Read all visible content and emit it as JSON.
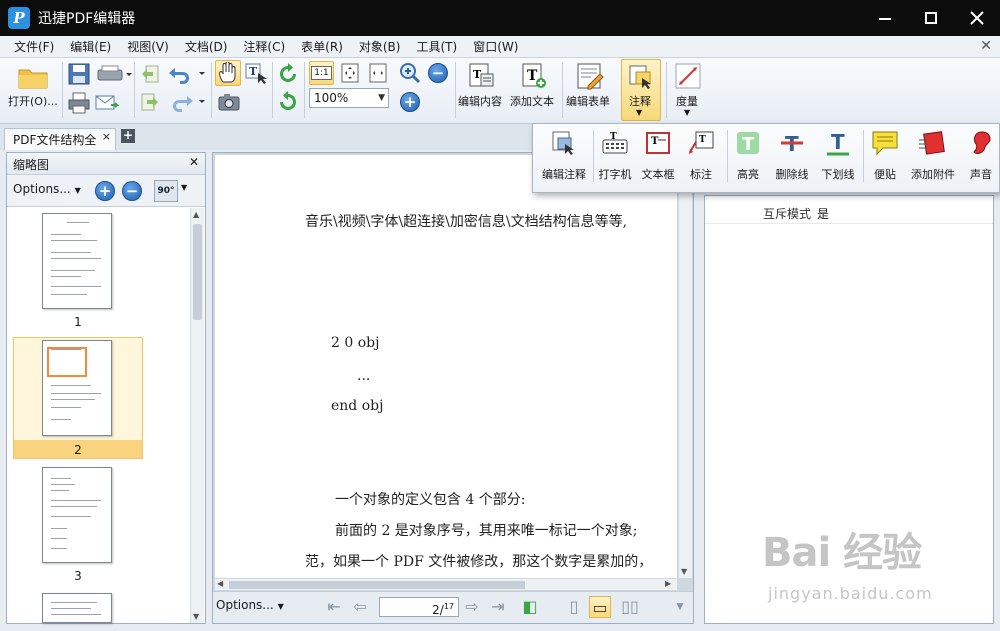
{
  "window": {
    "title": "迅捷PDF编辑器",
    "logo_letter": "P"
  },
  "menu": [
    "文件(F)",
    "编辑(E)",
    "视图(V)",
    "文档(D)",
    "注释(C)",
    "表单(R)",
    "对象(B)",
    "工具(T)",
    "窗口(W)"
  ],
  "toolbar": {
    "open_label": "打开(O)...",
    "zoom_value": "100%",
    "edit_content_label": "编辑内容",
    "add_text_label": "添加文本",
    "edit_form_label": "编辑表单",
    "annotate_label": "注释",
    "measure_label": "度量",
    "actual_size_label": "1:1"
  },
  "annotation_panel": {
    "items": [
      "编辑注释",
      "打字机",
      "文本框",
      "标注",
      "高亮",
      "删除线",
      "下划线",
      "便贴",
      "添加附件",
      "声音"
    ]
  },
  "tabs": {
    "document_tab": "PDF文件结构全",
    "close_symbol": "×",
    "new_tab_symbol": "+"
  },
  "thumbnail_panel": {
    "title": "缩略图",
    "options_label": "Options...",
    "rotate_label": "90°",
    "pages": [
      "1",
      "2",
      "3"
    ],
    "selected_page": "2"
  },
  "document": {
    "lines": [
      "音乐\\视频\\字体\\超连接\\加密信息\\文档结构信息等等,",
      "2 0 obj",
      "...",
      "end obj",
      "一个对象的定义包含 4 个部分:",
      "前面的 2 是对象序号，其用来唯一标记一个对象;",
      "范，如果一个 PDF 文件被修改，那这个数字是累加的，"
    ]
  },
  "page_nav": {
    "options_label": "Options...",
    "current_page": "2",
    "total_pages": "17"
  },
  "properties": {
    "key": "互斥模式",
    "value": "是"
  },
  "watermark": {
    "text": "Bai 经验",
    "url": "jingyan.baidu.com"
  }
}
